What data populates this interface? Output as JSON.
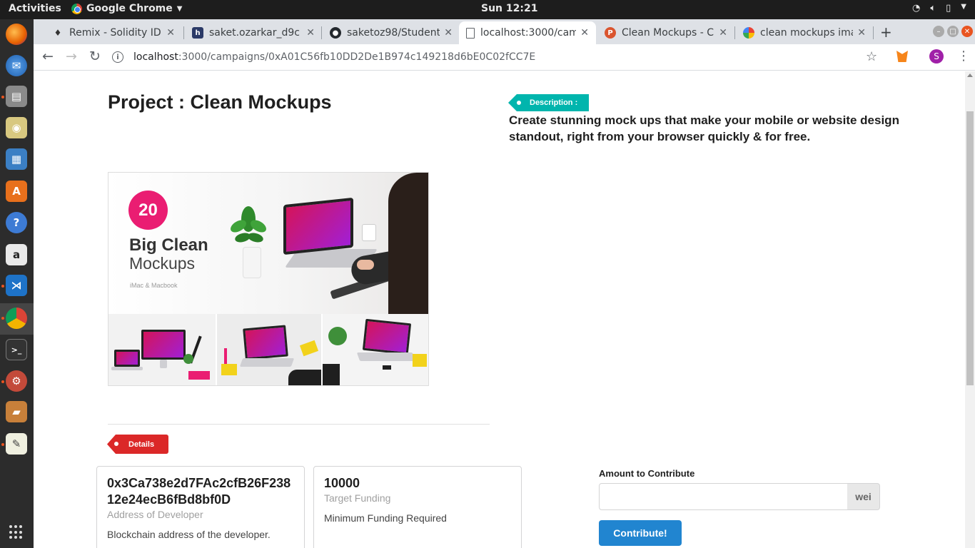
{
  "system": {
    "activities": "Activities",
    "app_name": "Google Chrome",
    "clock": "Sun 12:21"
  },
  "browser": {
    "tabs": [
      {
        "title": "Remix - Solidity IDE",
        "icon": "ethereum-icon"
      },
      {
        "title": "saket.ozarkar_d9c",
        "icon": "hackerrank-icon"
      },
      {
        "title": "saketoz98/Student",
        "icon": "github-icon"
      },
      {
        "title": "localhost:3000/cam",
        "icon": "page-icon",
        "active": true
      },
      {
        "title": "Clean Mockups - Cr",
        "icon": "producthunt-icon"
      },
      {
        "title": "clean mockups ima",
        "icon": "google-icon"
      }
    ],
    "url_host": "localhost",
    "url_path": ":3000/campaigns/0xA01C56fb10DD2De1B974c149218d6bE0C02fCC7E",
    "profile_initial": "S"
  },
  "page": {
    "title": "Project : Clean Mockups",
    "description_tag": "Description :",
    "description": "Create stunning mock ups that make your mobile or website design standout, right from your browser quickly & for free.",
    "image": {
      "badge": "20",
      "line1": "Big Clean",
      "line2": "Mockups",
      "line3": "iMac & Macbook"
    },
    "details_tag": "Details",
    "cards": [
      {
        "header": "0x3Ca738e2d7FAc2cfB26F23812e24ecB6fBd8bf0D",
        "meta": "Address of Developer",
        "description": "Blockchain address of the developer."
      },
      {
        "header": "10000",
        "meta": "Target Funding",
        "description": "Minimum Funding Required"
      }
    ],
    "contribute": {
      "label": "Amount to Contribute",
      "value": "",
      "unit": "wei",
      "button": "Contribute!"
    }
  },
  "colors": {
    "description_tag": "#00b5ad",
    "details_tag": "#db2828",
    "button": "#2185d0",
    "badge": "#ea1d72"
  }
}
